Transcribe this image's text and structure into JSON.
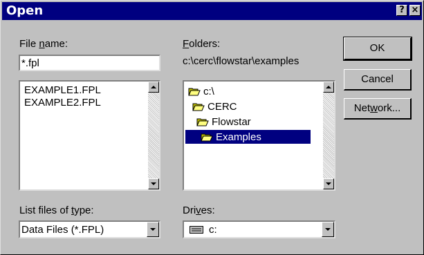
{
  "window": {
    "title": "Open",
    "help_button": "?",
    "close_button": "×"
  },
  "file_name": {
    "label_pre": "File ",
    "label_hot": "n",
    "label_post": "ame:",
    "value": "*.fpl",
    "files": [
      "EXAMPLE1.FPL",
      "EXAMPLE2.FPL"
    ]
  },
  "folders": {
    "label_hot": "F",
    "label_post": "olders:",
    "current_path": "c:\\cerc\\flowstar\\examples",
    "tree": [
      {
        "label": "c:\\",
        "selected": false
      },
      {
        "label": "CERC",
        "selected": false
      },
      {
        "label": "Flowstar",
        "selected": false
      },
      {
        "label": "Examples",
        "selected": true
      }
    ]
  },
  "file_type": {
    "label_pre": "List files of ",
    "label_hot": "t",
    "label_post": "ype:",
    "selected": "Data Files (*.FPL)"
  },
  "drives": {
    "label_pre": "Dri",
    "label_hot": "v",
    "label_post": "es:",
    "selected": "c:",
    "icon": "drive-icon"
  },
  "buttons": {
    "ok": "OK",
    "cancel": "Cancel",
    "network_pre": "Net",
    "network_hot": "w",
    "network_post": "ork..."
  }
}
